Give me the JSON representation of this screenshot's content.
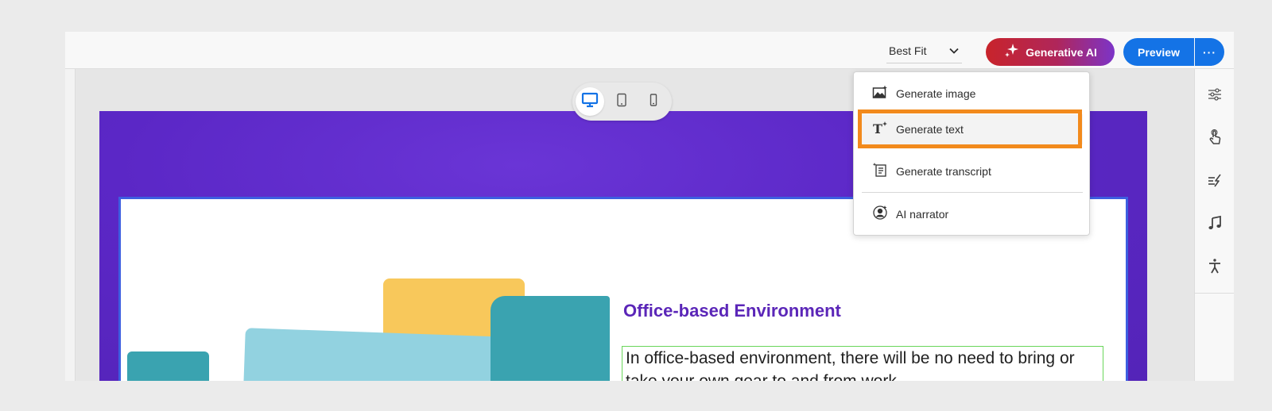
{
  "toolbar": {
    "zoom_label": "Best Fit",
    "generative_ai_label": "Generative AI",
    "preview_label": "Preview",
    "more_label": "···"
  },
  "device_switcher": {
    "items": [
      {
        "name": "desktop",
        "selected": true
      },
      {
        "name": "tablet",
        "selected": false
      },
      {
        "name": "mobile",
        "selected": false
      }
    ]
  },
  "generative_menu": {
    "items": [
      {
        "label": "Generate image",
        "icon": "image-sparkle-icon"
      },
      {
        "label": "Generate text",
        "icon": "text-sparkle-icon",
        "highlighted": true
      },
      {
        "label": "Generate transcript",
        "icon": "transcript-icon"
      },
      {
        "label": "AI narrator",
        "icon": "narrator-icon"
      }
    ]
  },
  "right_rail": {
    "icons": [
      "properties-icon",
      "interaction-icon",
      "effects-icon",
      "audio-icon",
      "accessibility-icon"
    ]
  },
  "slide": {
    "heading": "Office-based Environment",
    "body": "In office-based environment, there will be no need to bring or take your own gear to and from work"
  },
  "colors": {
    "accent_blue": "#1473e6",
    "highlight_orange": "#f28a1c",
    "canvas_purple": "#5b27c6",
    "heading_purple": "#5b26b8"
  }
}
